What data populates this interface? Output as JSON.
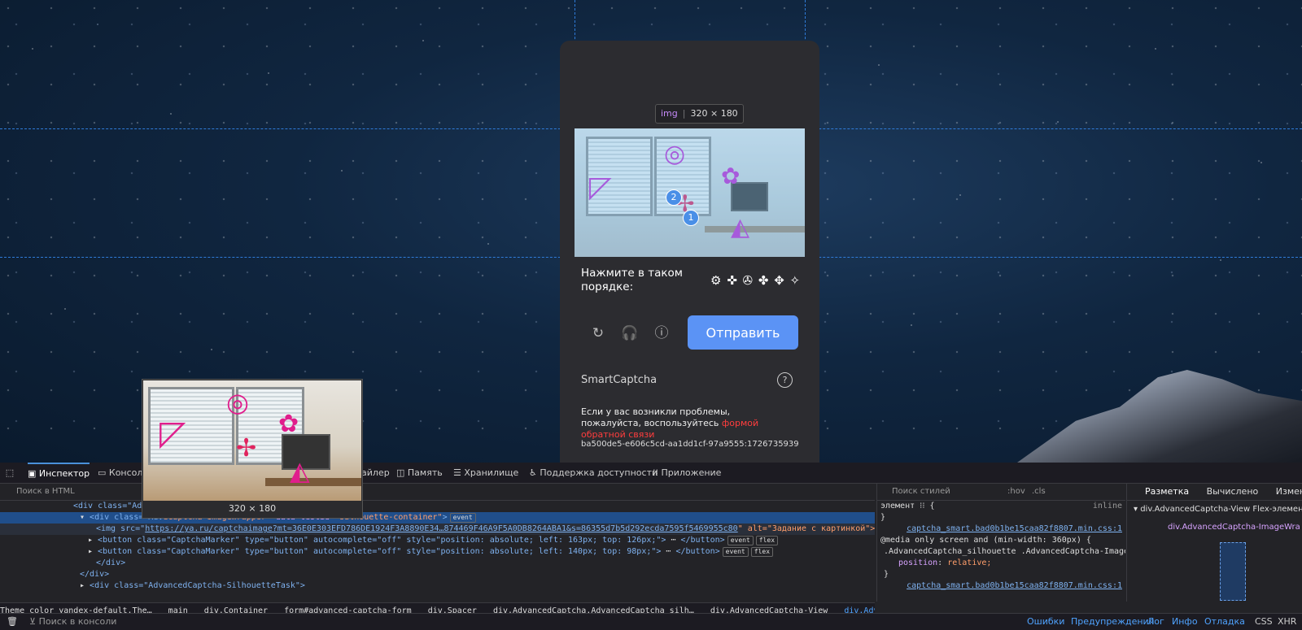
{
  "captcha": {
    "image_size_tag": "img",
    "image_size": "320 × 180",
    "markers": [
      "2",
      "1"
    ],
    "prompt": "Нажмите в таком порядке:",
    "silhouettes": "⚙ ✜ ✇ ✤ ✥ ✧",
    "icons": [
      "refresh-icon",
      "headphones-icon",
      "info-icon"
    ],
    "submit_label": "Отправить",
    "brand": "SmartCaptcha",
    "help_icon": "?",
    "problem_text": "Если у вас возникли проблемы, пожалуйста, воспользуйтесь",
    "problem_link": "формой обратной связи",
    "token": "ba500de5-e606c5cd-aa1dd1cf-97a9555:1726735939"
  },
  "tooltip": {
    "size": "320 × 180"
  },
  "devtools": {
    "tabs": [
      "Инспектор",
      "Консол",
      "айлер",
      "Память",
      "Хранилище",
      "Поддержка доступности",
      "Приложение"
    ],
    "search_html_placeholder": "Поиск в HTML",
    "html_lines": {
      "l1_tag": "<div class=\"Ad",
      "l2_open": "<div class=\"Adv",
      "l2_mid": "dCaptcha-ImageWrapper\"",
      "l2_attr": "data-testid",
      "l2_val": "\"silhouette-container\"",
      "l2_badge": "event",
      "l3_img": "<img src=\"",
      "l3_url": "https://ya.ru/captchaimage?mt=36E0E303EFD786DE1924F3A8890E34…874469F46A9F5A0DB8264ABA1&s=86355d7b5d292ecda7595f5469955c80",
      "l3_alt": "\" alt=\"Задание с картинкой\">",
      "l3_badge": "event",
      "l4": "<button class=\"CaptchaMarker\" type=\"button\" autocomplete=\"off\" style=\"position: absolute; left: 163px; top: 126px;\">",
      "l5": "<button class=\"CaptchaMarker\" type=\"button\" autocomplete=\"off\" style=\"position: absolute; left: 140px; top: 98px;\">",
      "btn_close": "</button>",
      "btn_badge1": "event",
      "btn_badge2": "flex",
      "close_div": "</div>",
      "l8": "<div class=\"AdvancedCaptcha-SilhouetteTask\">"
    },
    "breadcrumbs": [
      "Theme_color_yandex-default.The…",
      "main",
      "div.Container",
      "form#advanced-captcha-form",
      "div.Spacer",
      "div.AdvancedCaptcha.AdvancedCaptcha_silh…",
      "div.AdvancedCaptcha-View",
      "div.AdvancedCaptcha-ImageWrapper"
    ],
    "styles": {
      "search_placeholder": "Поиск стилей",
      "hov": ":hov",
      "cls": ".cls",
      "element_rule": "элемент ⁝⁝ {",
      "inline": "inline",
      "close_brace": "}",
      "source": "captcha_smart.bad0b1be15caa82f8807.min.css:1",
      "media": "@media only screen and (min-width: 360px) {",
      "selector": ".AdvancedCaptcha_silhouette .AdvancedCaptcha-ImageWrapper ⁝⁝ {",
      "prop": "position",
      "value": "relative;",
      "source2": "captcha_smart.bad0b1be15caa82f8807.min.css:1"
    },
    "layout": {
      "tabs": [
        "Разметка",
        "Вычислено",
        "Измене"
      ],
      "flex_title": "div.AdvancedCaptcha-View Flex-элемен",
      "child": "div.AdvancedCaptcha-ImageWra"
    },
    "console": {
      "placeholder": "Поиск в консоли",
      "filters": [
        "Ошибки",
        "Предупреждения",
        "Лог",
        "Инфо",
        "Отладка"
      ],
      "css": "CSS",
      "xhr": "XHR"
    }
  }
}
